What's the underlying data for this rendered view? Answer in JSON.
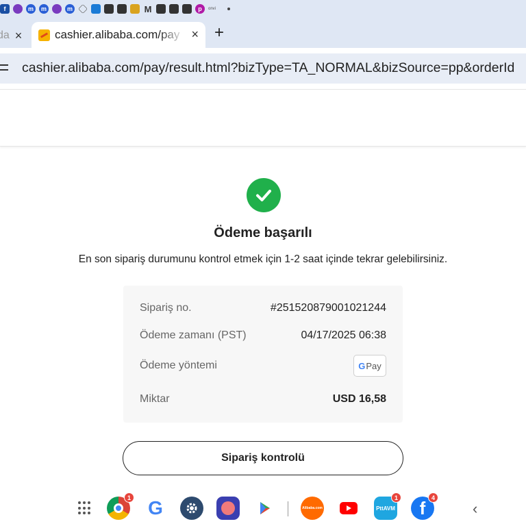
{
  "browser": {
    "active_tab_title": "cashier.alibaba.com/pay",
    "previous_tab_fragment": "da",
    "url": "cashier.alibaba.com/pay/result.html?bizType=TA_NORMAL&bizSource=pp&orderId",
    "new_tab_label": "+",
    "close_label": "×"
  },
  "bookmarks": {
    "items": [
      "f-icon",
      "crunchyroll-icon",
      "m-icon",
      "m-icon",
      "crunchyroll-icon",
      "m-icon",
      "diamond-icon",
      "card-icon",
      "cube-icon",
      "cube-icon",
      "cards-icon",
      "gmail-icon",
      "mail-icon",
      "mail-icon",
      "document-icon",
      "p-icon"
    ],
    "trailing_text": "onvi"
  },
  "payment": {
    "title": "Ödeme başarılı",
    "subtitle": "En son sipariş durumunu kontrol etmek için 1-2 saat içinde tekrar gelebilirsiniz.",
    "rows": [
      {
        "label": "Sipariş no.",
        "value": "#251520879001021244"
      },
      {
        "label": "Ödeme zamanı (PST)",
        "value": "04/17/2025 06:38"
      },
      {
        "label": "Ödeme yöntemi",
        "value": "Pay"
      },
      {
        "label": "Miktar",
        "value": "USD 16,58"
      }
    ],
    "gpay_g": "G",
    "button_label": "Sipariş kontrolü"
  },
  "dock": {
    "apps": [
      {
        "name": "chrome",
        "badge": "1"
      },
      {
        "name": "google",
        "label": "G"
      },
      {
        "name": "settings"
      },
      {
        "name": "screen-recorder"
      },
      {
        "name": "play-store"
      },
      {
        "name": "alibaba",
        "label": "Alibaba.com"
      },
      {
        "name": "youtube"
      },
      {
        "name": "pttavm",
        "label": "PttAVM",
        "badge": "1"
      },
      {
        "name": "facebook",
        "label": "f",
        "badge": "4"
      }
    ]
  },
  "colors": {
    "success": "#20b04b",
    "tabstrip": "#dfe7f4",
    "addressbar": "#e8edf6"
  }
}
